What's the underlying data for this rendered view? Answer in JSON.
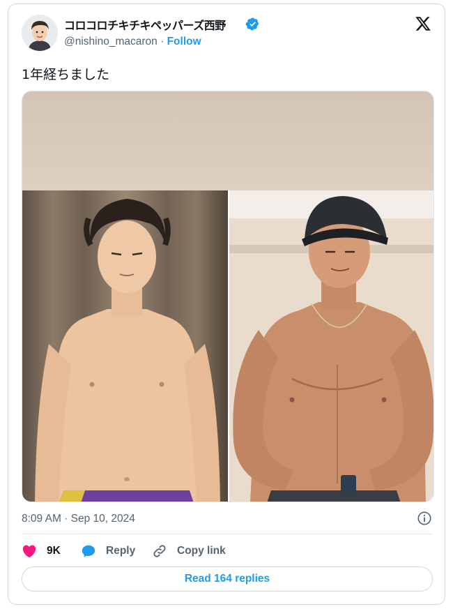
{
  "author": {
    "display_name": "コロコロチキチキペッパーズ西野",
    "handle": "@nishino_macaron",
    "separator": "·",
    "follow_label": "Follow"
  },
  "tweet": {
    "text": "1年経ちました",
    "timestamp": "8:09 AM · Sep 10, 2024"
  },
  "actions": {
    "like_count": "9K",
    "reply_label": "Reply",
    "copy_link_label": "Copy link"
  },
  "replies_button_label": "Read 164 replies",
  "colors": {
    "accent": "#1d9bf0",
    "like": "#f91880",
    "secondary_text": "#536471",
    "border": "#cfd9de"
  },
  "icons": {
    "verified": "verified-badge-icon",
    "platform": "x-logo-icon",
    "info": "info-icon",
    "like": "heart-icon",
    "reply": "speech-bubble-icon",
    "copy": "link-icon"
  }
}
